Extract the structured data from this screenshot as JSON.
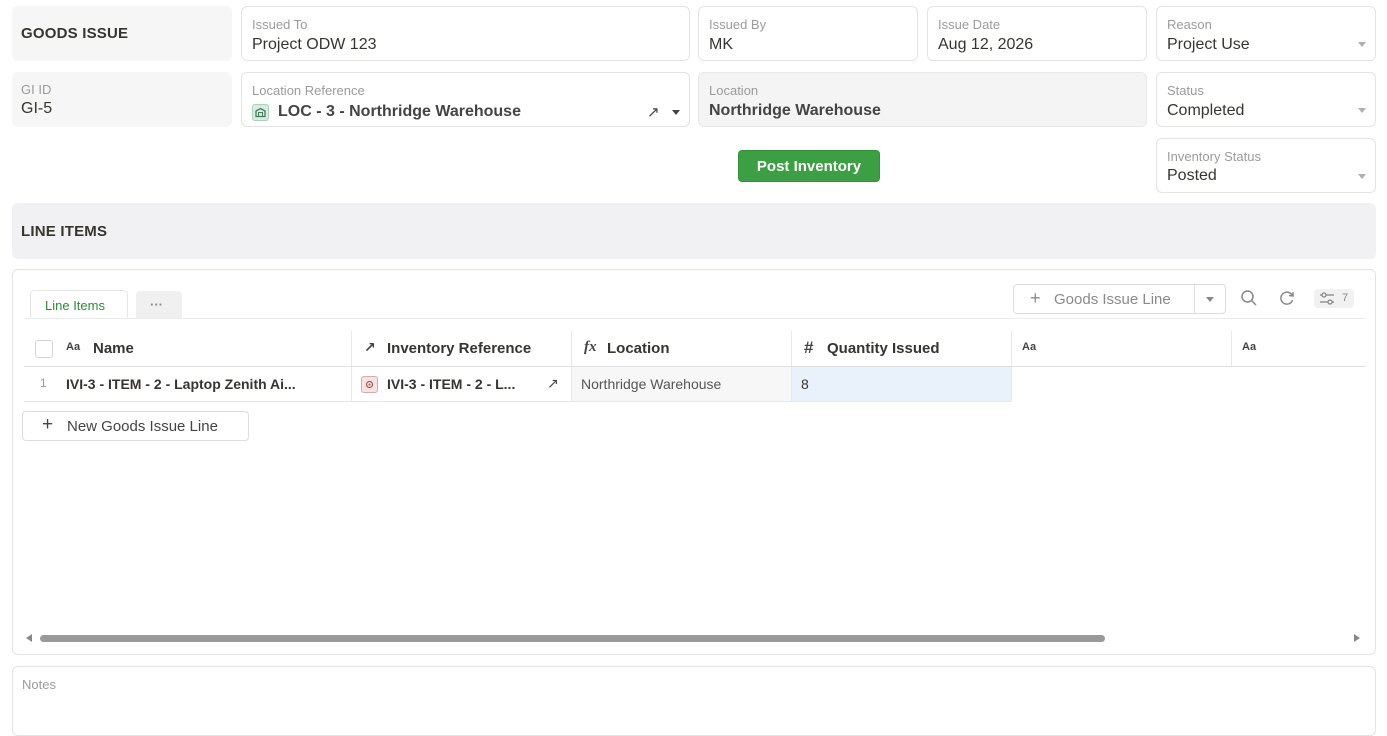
{
  "header": {
    "section_title": "GOODS ISSUE",
    "issued_to": {
      "label": "Issued To",
      "value": "Project ODW 123"
    },
    "issued_by": {
      "label": "Issued By",
      "value": "MK"
    },
    "issue_date": {
      "label": "Issue Date",
      "value": "Aug 12, 2026"
    },
    "reason": {
      "label": "Reason",
      "value": "Project Use"
    },
    "gi_id": {
      "label": "GI ID",
      "value": "GI-5"
    },
    "location_reference": {
      "label": "Location Reference",
      "value": "LOC - 3 - Northridge Warehouse"
    },
    "location": {
      "label": "Location",
      "value": "Northridge Warehouse"
    },
    "status": {
      "label": "Status",
      "value": "Completed"
    },
    "inventory_status": {
      "label": "Inventory Status",
      "value": "Posted"
    },
    "post_button": "Post Inventory"
  },
  "line_items": {
    "section_title": "LINE ITEMS",
    "tabs": [
      {
        "label": "Line Items",
        "active": true
      },
      {
        "label": "···"
      }
    ],
    "toolbar": {
      "add_label": "Goods Issue Line",
      "filter_count": "7"
    },
    "columns": [
      {
        "label": "Name",
        "icon": "Aa"
      },
      {
        "label": "Inventory Reference",
        "icon": "↗"
      },
      {
        "label": "Location",
        "icon": "fx"
      },
      {
        "label": "Quantity Issued",
        "icon": "#"
      },
      {
        "label": "",
        "icon": "Aa"
      },
      {
        "label": "",
        "icon": "Aa"
      }
    ],
    "rows": [
      {
        "index": "1",
        "name": "IVI-3 - ITEM - 2 - Laptop Zenith Ai...",
        "inventory_reference": "IVI-3 - ITEM - 2 - L...",
        "location": "Northridge Warehouse",
        "quantity_issued": "8"
      }
    ],
    "new_line_label": "New Goods Issue Line"
  },
  "notes": {
    "label": "Notes"
  },
  "colors": {
    "accent_green": "#3d9f44",
    "tab_green": "#2e8b3a",
    "highlight_cell": "#e9f1fb"
  }
}
